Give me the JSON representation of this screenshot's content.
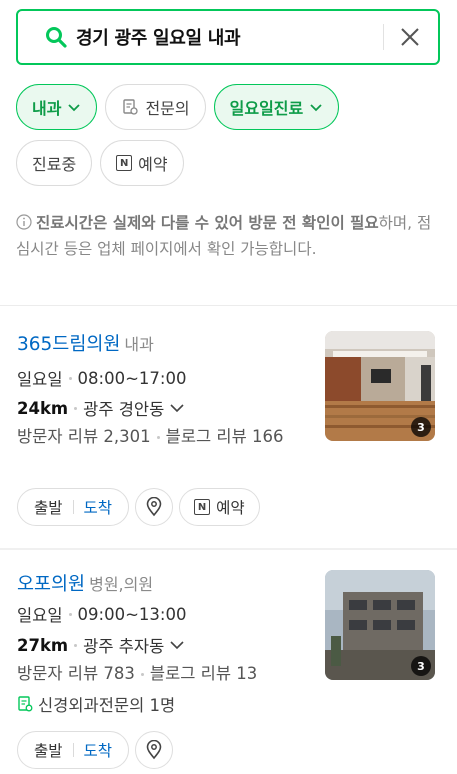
{
  "search": {
    "query": "경기 광주 일요일 내과"
  },
  "filters": {
    "row1": [
      {
        "label": "내과",
        "active": true,
        "icon": "chevron-down-icon"
      },
      {
        "label": "전문의",
        "active": false,
        "icon": "certificate-icon"
      },
      {
        "label": "일요일진료",
        "active": true,
        "icon": "chevron-down-icon"
      }
    ],
    "row2": [
      {
        "label": "진료중",
        "active": false
      },
      {
        "label": "예약",
        "active": false,
        "icon": "naver-booking-icon"
      }
    ]
  },
  "notice": {
    "bold": "진료시간은 실제와 다를 수 있어 방문 전 확인이 필요",
    "rest": "하며, 점심시간 등은 업체 페이지에서 확인 가능합니다."
  },
  "places": [
    {
      "name": "365드림의원",
      "category": "내과",
      "day": "일요일",
      "hours": "08:00~17:00",
      "distance": "24km",
      "area": "광주 경안동",
      "visitor_review": "방문자 리뷰 2,301",
      "blog_review": "블로그 리뷰 166",
      "photo_count": "3",
      "actions": {
        "depart": "출발",
        "arrive": "도착",
        "reserve": "예약"
      }
    },
    {
      "name": "오포의원",
      "category": "병원,의원",
      "day": "일요일",
      "hours": "09:00~13:00",
      "distance": "27km",
      "area": "광주 추자동",
      "visitor_review": "방문자 리뷰 783",
      "blog_review": "블로그 리뷰 13",
      "specialist": "신경외과전문의 1명",
      "photo_count": "3",
      "actions": {
        "depart": "출발",
        "arrive": "도착"
      }
    }
  ],
  "colors": {
    "brand_green": "#03c75a",
    "link_blue": "#0068c3"
  }
}
